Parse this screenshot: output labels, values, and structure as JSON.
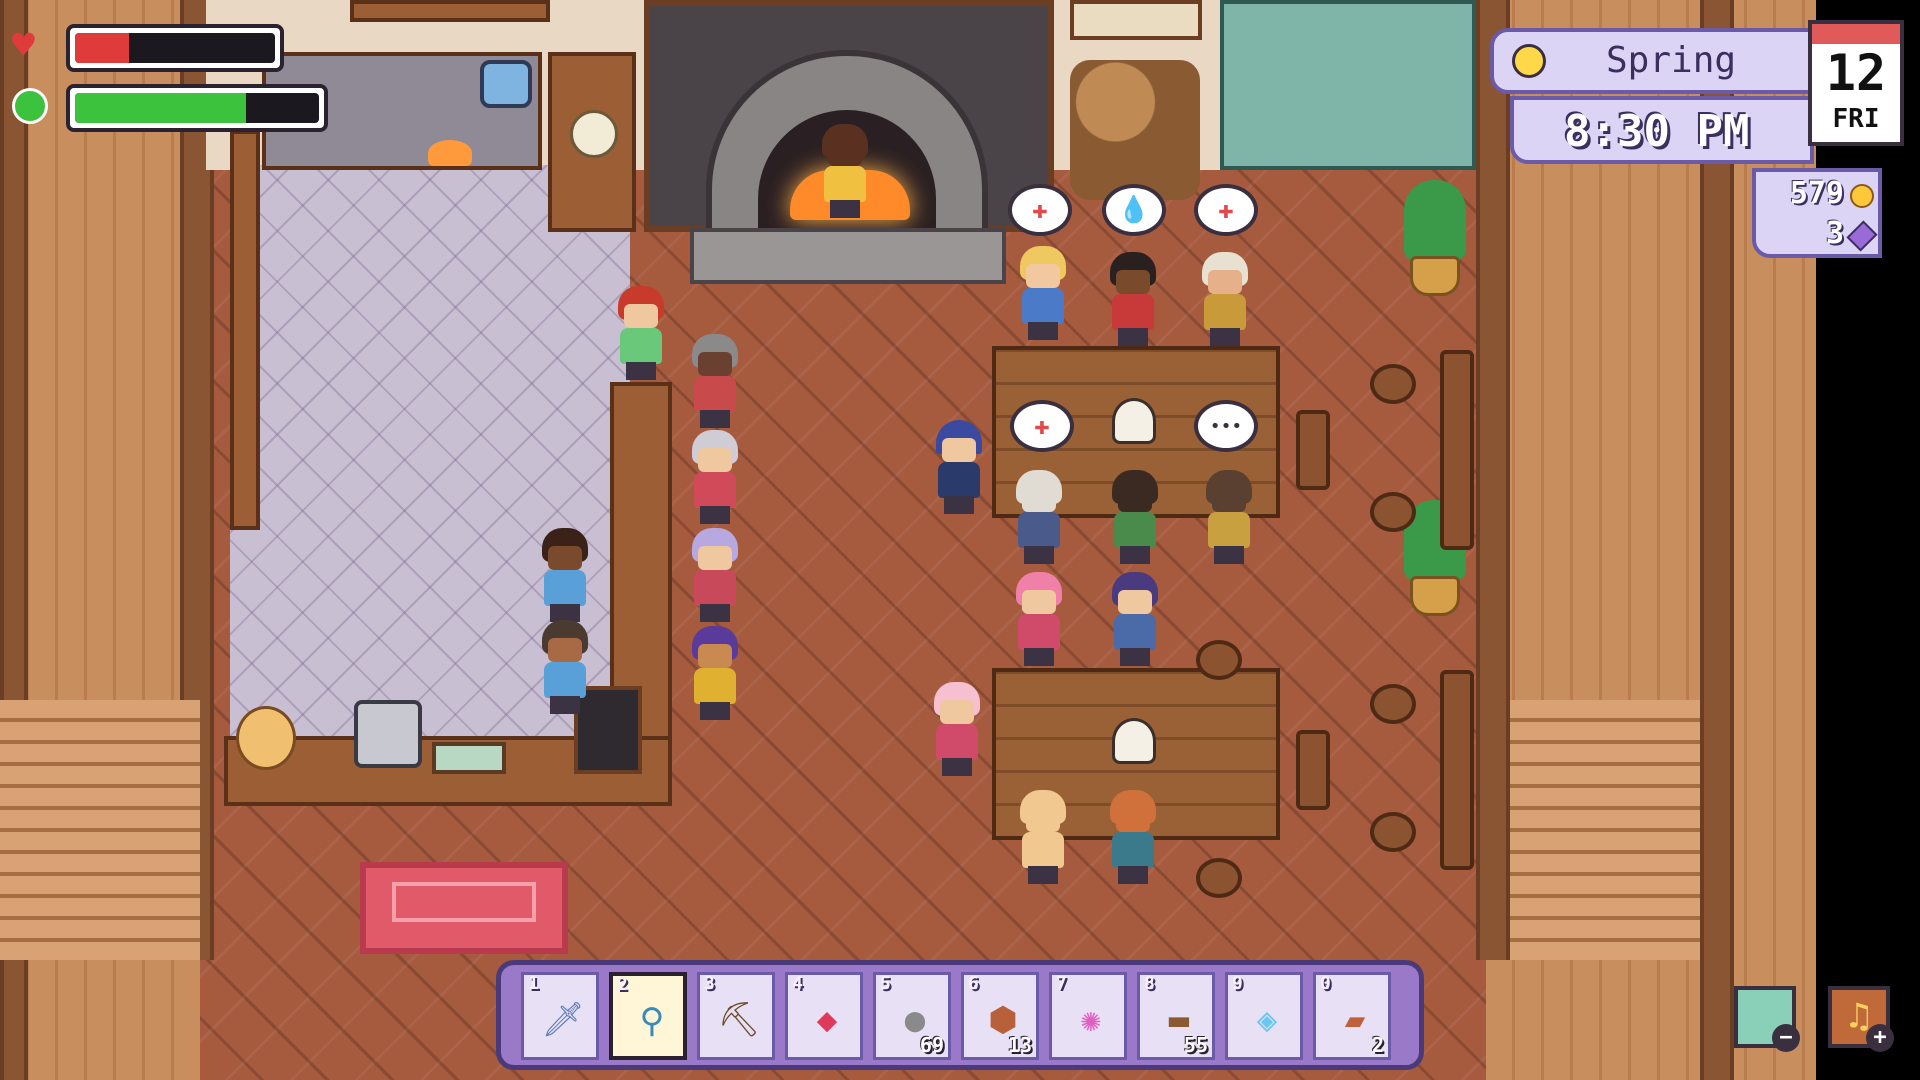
{
  "hud": {
    "season": "Spring",
    "time": "8:30 PM",
    "day_number": "12",
    "weekday": "FRI",
    "gold": "579",
    "gems": "3",
    "health_fraction": 0.27,
    "energy_fraction": 0.7,
    "colors": {
      "health": "#e03b3b",
      "energy": "#3cc23c",
      "panel": "#dcd4f4",
      "panel_border": "#6a5aa8"
    }
  },
  "hotbar": {
    "selected_slot": 2,
    "slots": [
      {
        "key": "1",
        "icon": "sword-icon",
        "count": ""
      },
      {
        "key": "2",
        "icon": "net-icon",
        "count": ""
      },
      {
        "key": "3",
        "icon": "pickaxe-icon",
        "count": ""
      },
      {
        "key": "4",
        "icon": "ruby-icon",
        "count": ""
      },
      {
        "key": "5",
        "icon": "stone-icon",
        "count": "69"
      },
      {
        "key": "6",
        "icon": "copper-ore-icon",
        "count": "13"
      },
      {
        "key": "7",
        "icon": "pink-orb-icon",
        "count": ""
      },
      {
        "key": "8",
        "icon": "wood-log-icon",
        "count": "55"
      },
      {
        "key": "9",
        "icon": "crystal-icon",
        "count": ""
      },
      {
        "key": "0",
        "icon": "brick-icon",
        "count": "2"
      }
    ]
  },
  "corner_buttons": {
    "map": "map-zoom-out-icon",
    "music": "music-zoom-in-icon"
  },
  "speech_bubbles": [
    "heart-bubble",
    "water-bubble",
    "heart-bubble",
    "heart-bubble",
    "ellipsis-bubble"
  ],
  "ellipsis_text": "•••"
}
